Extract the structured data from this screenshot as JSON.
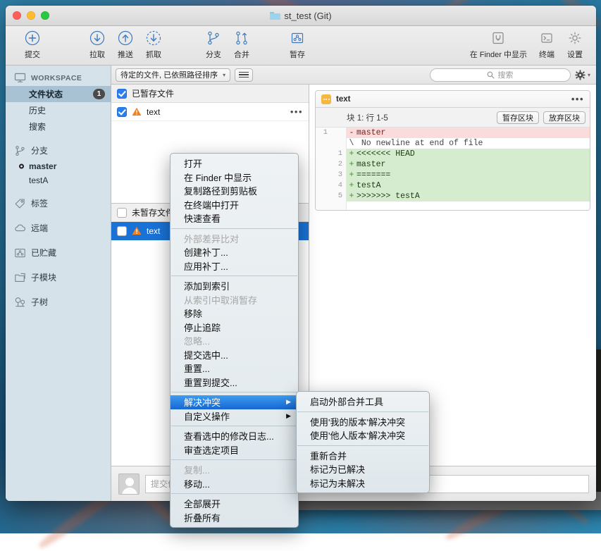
{
  "window": {
    "title": "st_test (Git)",
    "folder_icon": "folder-icon",
    "traffic_lights": [
      "close",
      "minimize",
      "zoom"
    ]
  },
  "toolbar": {
    "buttons": [
      {
        "label": "提交",
        "icon": "plus-circle-icon"
      },
      {
        "label": "拉取",
        "icon": "arrow-down-circle-icon"
      },
      {
        "label": "推送",
        "icon": "arrow-up-circle-icon"
      },
      {
        "label": "抓取",
        "icon": "arrow-down-dashed-circle-icon"
      },
      {
        "label": "分支",
        "icon": "branch-icon"
      },
      {
        "label": "合并",
        "icon": "merge-icon"
      },
      {
        "label": "暂存",
        "icon": "stash-icon"
      }
    ],
    "right_buttons": [
      {
        "label": "在 Finder 中显示",
        "icon": "finder-icon"
      },
      {
        "label": "终端",
        "icon": "terminal-icon"
      },
      {
        "label": "设置",
        "icon": "gear-icon"
      }
    ]
  },
  "sidebar": {
    "header": {
      "label": "WORKSPACE",
      "icon": "monitor-icon"
    },
    "workspace_items": [
      {
        "label": "文件状态",
        "badge": "1",
        "selected": true
      },
      {
        "label": "历史",
        "badge": "",
        "selected": false
      },
      {
        "label": "搜索",
        "badge": "",
        "selected": false
      }
    ],
    "groups": [
      {
        "label": "分支",
        "icon": "branch-icon",
        "items": [
          {
            "label": "master",
            "bold": true,
            "dot": true
          },
          {
            "label": "testA",
            "bold": false,
            "dot": false
          }
        ]
      },
      {
        "label": "标签",
        "icon": "tag-icon",
        "items": []
      },
      {
        "label": "远端",
        "icon": "cloud-icon",
        "items": []
      },
      {
        "label": "已贮藏",
        "icon": "stash-icon",
        "items": []
      },
      {
        "label": "子模块",
        "icon": "submodule-icon",
        "items": []
      },
      {
        "label": "子树",
        "icon": "subtree-icon",
        "items": []
      }
    ]
  },
  "filter_bar": {
    "sort_label": "待定的文件, 已依照路径排序",
    "view_toggle_icon": "list-view-icon",
    "search_placeholder": "搜索",
    "search_icon": "search-icon",
    "settings_icon": "gear-icon"
  },
  "file_list": {
    "staged": {
      "header": "已暂存文件",
      "header_checked": true,
      "rows": [
        {
          "name": "text",
          "checked": true,
          "status_icon": "conflict-warning-icon",
          "menu_icon": "more-dots-icon",
          "selected": false
        }
      ]
    },
    "unstaged": {
      "header": "未暂存文件",
      "header_checked": false,
      "rows": [
        {
          "name": "text",
          "checked": false,
          "status_icon": "conflict-warning-icon",
          "menu_icon": "",
          "selected": true
        }
      ]
    }
  },
  "diff": {
    "file_name": "text",
    "file_icon": "file-badge-icon",
    "more_icon": "more-dots-icon",
    "hunk_label": "块 1:  行 1-5",
    "stage_hunk_button": "暂存区块",
    "discard_hunk_button": "放弃区块",
    "lines": [
      {
        "old": "1",
        "new": "",
        "sign": "-",
        "text": "master",
        "type": "del"
      },
      {
        "old": "",
        "new": "",
        "sign": "\\",
        "text": " No newline at end of file",
        "type": "meta"
      },
      {
        "old": "",
        "new": "1",
        "sign": "+",
        "text": "<<<<<<< HEAD",
        "type": "add"
      },
      {
        "old": "",
        "new": "2",
        "sign": "+",
        "text": "master",
        "type": "add"
      },
      {
        "old": "",
        "new": "3",
        "sign": "+",
        "text": "=======",
        "type": "add"
      },
      {
        "old": "",
        "new": "4",
        "sign": "+",
        "text": "testA",
        "type": "add"
      },
      {
        "old": "",
        "new": "5",
        "sign": "+",
        "text": ">>>>>>> testA",
        "type": "add"
      }
    ]
  },
  "commit_bar": {
    "avatar_icon": "avatar-icon",
    "message_placeholder": "提交信息"
  },
  "context_menu": {
    "groups": [
      {
        "items": [
          {
            "label": "打开",
            "state": "normal"
          },
          {
            "label": "在 Finder 中显示",
            "state": "normal"
          },
          {
            "label": "复制路径到剪贴板",
            "state": "normal"
          },
          {
            "label": "在终端中打开",
            "state": "normal"
          },
          {
            "label": "快速查看",
            "state": "normal"
          }
        ]
      },
      {
        "items": [
          {
            "label": "外部差异比对",
            "state": "disabled"
          },
          {
            "label": "创建补丁...",
            "state": "normal"
          },
          {
            "label": "应用补丁...",
            "state": "normal"
          }
        ]
      },
      {
        "items": [
          {
            "label": "添加到索引",
            "state": "normal"
          },
          {
            "label": "从索引中取消暂存",
            "state": "disabled"
          },
          {
            "label": "移除",
            "state": "normal"
          },
          {
            "label": "停止追踪",
            "state": "normal"
          },
          {
            "label": "忽略...",
            "state": "disabled"
          },
          {
            "label": "提交选中...",
            "state": "normal"
          },
          {
            "label": "重置...",
            "state": "normal"
          },
          {
            "label": "重置到提交...",
            "state": "normal"
          }
        ]
      },
      {
        "items": [
          {
            "label": "解决冲突",
            "state": "highlight",
            "submenu": true
          },
          {
            "label": "自定义操作",
            "state": "normal",
            "submenu": true
          }
        ]
      },
      {
        "items": [
          {
            "label": "查看选中的修改日志...",
            "state": "normal"
          },
          {
            "label": "审查选定项目",
            "state": "normal"
          }
        ]
      },
      {
        "items": [
          {
            "label": "复制...",
            "state": "disabled"
          },
          {
            "label": "移动...",
            "state": "normal"
          }
        ]
      },
      {
        "items": [
          {
            "label": "全部展开",
            "state": "normal"
          },
          {
            "label": "折叠所有",
            "state": "normal"
          }
        ]
      }
    ]
  },
  "submenu": {
    "groups": [
      {
        "items": [
          {
            "label": "启动外部合并工具",
            "state": "normal"
          }
        ]
      },
      {
        "items": [
          {
            "label": "使用'我的版本'解决冲突",
            "state": "normal"
          },
          {
            "label": "使用'他人版本'解决冲突",
            "state": "normal"
          }
        ]
      },
      {
        "items": [
          {
            "label": "重新合并",
            "state": "normal"
          },
          {
            "label": "标记为已解决",
            "state": "normal"
          },
          {
            "label": "标记为未解决",
            "state": "normal"
          }
        ]
      }
    ]
  },
  "colors": {
    "accent_blue": "#1a72d6",
    "menu_highlight": "#1667d4",
    "sidebar_bg": "#d6e2ea",
    "sidebar_selected": "#a9c2d3",
    "diff_add": "#d6ecce",
    "diff_del": "#fadcdc",
    "warning_orange": "#f08020"
  }
}
